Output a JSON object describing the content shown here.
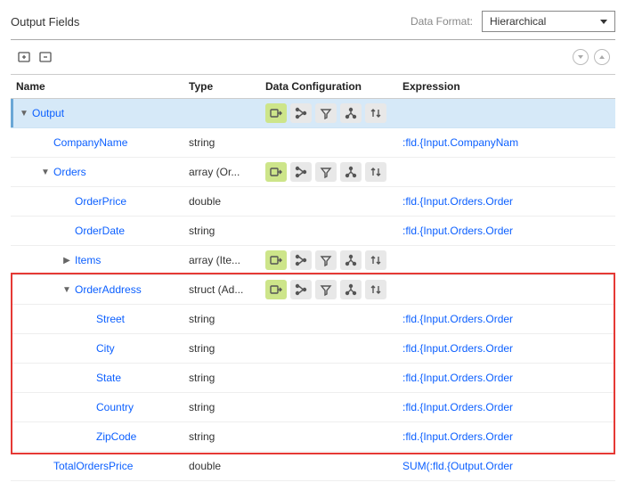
{
  "title": "Output Fields",
  "format": {
    "label": "Data Format:",
    "value": "Hierarchical"
  },
  "columns": {
    "name": "Name",
    "type": "Type",
    "cfg": "Data Configuration",
    "expr": "Expression"
  },
  "rows": [
    {
      "indent": 0,
      "toggle": "down",
      "name": "Output",
      "type": "",
      "cfg": true,
      "expr": "",
      "selected": true
    },
    {
      "indent": 1,
      "toggle": "",
      "name": "CompanyName",
      "type": "string",
      "cfg": false,
      "expr": ":fld.{Input.CompanyNam"
    },
    {
      "indent": 1,
      "toggle": "down",
      "name": "Orders",
      "type": "array (Or...",
      "cfg": true,
      "expr": ""
    },
    {
      "indent": 2,
      "toggle": "",
      "name": "OrderPrice",
      "type": "double",
      "cfg": false,
      "expr": ":fld.{Input.Orders.Order"
    },
    {
      "indent": 2,
      "toggle": "",
      "name": "OrderDate",
      "type": "string",
      "cfg": false,
      "expr": ":fld.{Input.Orders.Order"
    },
    {
      "indent": 2,
      "toggle": "right",
      "name": "Items",
      "type": "array (Ite...",
      "cfg": true,
      "expr": ""
    },
    {
      "indent": 2,
      "toggle": "down",
      "name": "OrderAddress",
      "type": "struct (Ad...",
      "cfg": true,
      "expr": ""
    },
    {
      "indent": 3,
      "toggle": "",
      "name": "Street",
      "type": "string",
      "cfg": false,
      "expr": ":fld.{Input.Orders.Order"
    },
    {
      "indent": 3,
      "toggle": "",
      "name": "City",
      "type": "string",
      "cfg": false,
      "expr": ":fld.{Input.Orders.Order"
    },
    {
      "indent": 3,
      "toggle": "",
      "name": "State",
      "type": "string",
      "cfg": false,
      "expr": ":fld.{Input.Orders.Order"
    },
    {
      "indent": 3,
      "toggle": "",
      "name": "Country",
      "type": "string",
      "cfg": false,
      "expr": ":fld.{Input.Orders.Order"
    },
    {
      "indent": 3,
      "toggle": "",
      "name": "ZipCode",
      "type": "string",
      "cfg": false,
      "expr": ":fld.{Input.Orders.Order"
    },
    {
      "indent": 1,
      "toggle": "",
      "name": "TotalOrdersPrice",
      "type": "double",
      "cfg": false,
      "expr": "SUM(:fld.{Output.Order"
    }
  ],
  "highlight": {
    "startRow": 6,
    "endRow": 11
  }
}
